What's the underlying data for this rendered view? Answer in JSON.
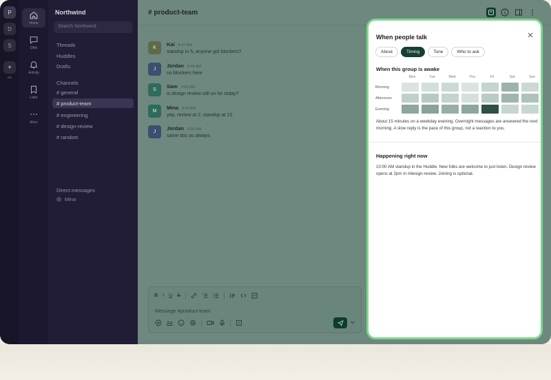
{
  "workspaces": {
    "items": [
      "P",
      "D",
      "S"
    ],
    "add_label": "+",
    "more_label": "ws"
  },
  "nav": {
    "items": [
      {
        "label": "Home",
        "icon": "home-icon"
      },
      {
        "label": "DMs",
        "icon": "chat-icon"
      },
      {
        "label": "Activity",
        "icon": "bell-icon"
      },
      {
        "label": "Later",
        "icon": "bookmark-icon"
      },
      {
        "label": "More",
        "icon": "ellipsis-icon"
      }
    ]
  },
  "sidebar": {
    "workspace_name": "Northwind",
    "search_placeholder": "Search Northwind",
    "top_items": [
      "Threads",
      "Huddles",
      "Drafts"
    ],
    "channels_header": "Channels",
    "channels": [
      "# general",
      "# product-team",
      "# engineering",
      "# design-review",
      "# random"
    ],
    "dm_header": "Direct messages",
    "dms": [
      "Mina"
    ]
  },
  "channel": {
    "title": "# product-team"
  },
  "messages": [
    {
      "initial": "K",
      "name": "Kai",
      "time": "8:47 AM",
      "text": "standup in 5, anyone got blockers?",
      "color": "#5d6b4a"
    },
    {
      "initial": "J",
      "name": "Jordan",
      "time": "8:49 AM",
      "text": "no blockers here",
      "color": "#3b4f6e"
    },
    {
      "initial": "S",
      "name": "Sam",
      "time": "9:02 AM",
      "text": "is design review still on for today?",
      "color": "#2e6b5c"
    },
    {
      "initial": "M",
      "name": "Mina",
      "time": "9:05 AM",
      "text": "yep, review at 2, standup at 10",
      "color": "#2e6b5c"
    },
    {
      "initial": "J",
      "name": "Jordan",
      "time": "9:06 AM",
      "text": "same doc as always",
      "color": "#3b4f6e"
    }
  ],
  "composer": {
    "format": {
      "bold": "B",
      "italic": "I",
      "underline": "U",
      "strike": "S"
    },
    "placeholder": "Message #product-team",
    "text_style_label": "Aa"
  },
  "panel": {
    "title": "When people talk",
    "tabs": [
      "About",
      "Timing",
      "Tone",
      "Who to ask"
    ],
    "active_tab": "Timing",
    "awake_title": "When this group is awake",
    "days": [
      "Mon",
      "Tue",
      "Wed",
      "Thu",
      "Fri",
      "Sat",
      "Sun"
    ],
    "rows": [
      {
        "label": "Morning",
        "colors": [
          "#d9e3e0",
          "#d3dfdb",
          "#ccdad5",
          "#dae3e0",
          "#c4d4ce",
          "#9cb3aa",
          "#cbd8d3"
        ]
      },
      {
        "label": "Afternoon",
        "colors": [
          "#bfd0ca",
          "#b7c9c3",
          "#c3d3cd",
          "#d5dfdc",
          "#b8cbc4",
          "#9fb6ad",
          "#aec2bb"
        ]
      },
      {
        "label": "Evening",
        "colors": [
          "#8ea69d",
          "#8aa298",
          "#98ada5",
          "#8fa69d",
          "#2e5046",
          "#c6d5cf",
          "#c9d7d2"
        ]
      }
    ],
    "awake_note": "About 15 minutes on a weekday evening. Overnight messages are answered the next morning. A slow reply is the pace of this group, not a reaction to you.",
    "now_title": "Happening right now",
    "now_text": "10:00 AM standup in the Huddle. New folks are welcome to just listen. Design review opens at 2pm in #design-review. Joining is optional."
  }
}
